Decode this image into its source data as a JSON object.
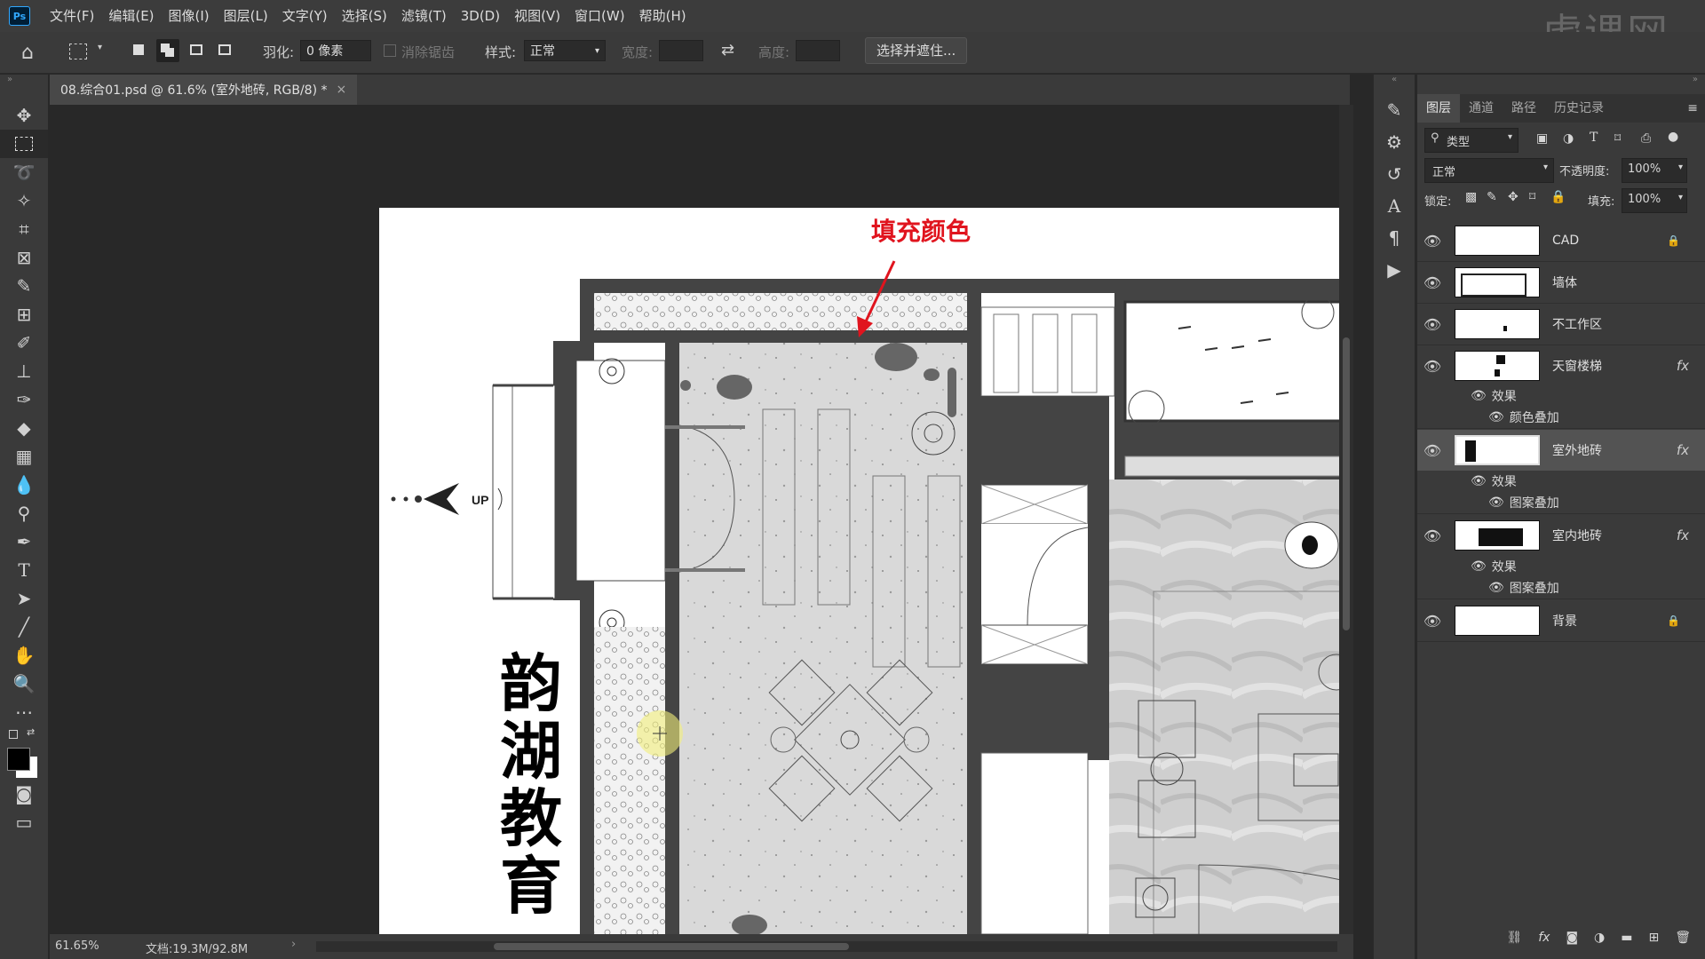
{
  "app": {
    "logo": "Ps",
    "menu": [
      "文件(F)",
      "编辑(E)",
      "图像(I)",
      "图层(L)",
      "文字(Y)",
      "选择(S)",
      "滤镜(T)",
      "3D(D)",
      "视图(V)",
      "窗口(W)",
      "帮助(H)"
    ],
    "watermark": "虎课网"
  },
  "options": {
    "feather_label": "羽化:",
    "feather_value": "0 像素",
    "antialias_label": "消除锯齿",
    "style_label": "样式:",
    "style_value": "正常",
    "width_label": "宽度:",
    "height_label": "高度:",
    "select_mask_button": "选择并遮住..."
  },
  "document": {
    "tab_title": "08.综合01.psd @ 61.6% (室外地砖, RGB/8) *",
    "close_glyph": "×",
    "zoom": "61.65%",
    "doc_size": "文档:19.3M/92.8M",
    "annotation": "填充颜色",
    "plan_text": [
      "韵",
      "湖",
      "教",
      "育"
    ],
    "up_label": "UP"
  },
  "panel": {
    "tabs": [
      "图层",
      "通道",
      "路径",
      "历史记录"
    ],
    "filter_label": "类型",
    "blend_mode": "正常",
    "opacity_label": "不透明度:",
    "opacity_value": "100%",
    "lock_label": "锁定:",
    "fill_label": "填充:",
    "fill_value": "100%",
    "layers": [
      {
        "name": "CAD",
        "locked": true,
        "fx": false
      },
      {
        "name": "墙体",
        "locked": false,
        "fx": false
      },
      {
        "name": "不工作区",
        "locked": false,
        "fx": false
      },
      {
        "name": "天窗楼梯",
        "locked": false,
        "fx": true,
        "effects_label": "效果",
        "effect": "颜色叠加"
      },
      {
        "name": "室外地砖",
        "locked": false,
        "fx": true,
        "effects_label": "效果",
        "effect": "图案叠加",
        "selected": true
      },
      {
        "name": "室内地砖",
        "locked": false,
        "fx": true,
        "effects_label": "效果",
        "effect": "图案叠加"
      },
      {
        "name": "背景",
        "locked": true,
        "fx": false
      }
    ],
    "fx_glyph": "fx"
  },
  "colors": {
    "accent_red": "#e0141e",
    "selection_bg": "#535353",
    "panel_bg": "#3a3a3a"
  }
}
